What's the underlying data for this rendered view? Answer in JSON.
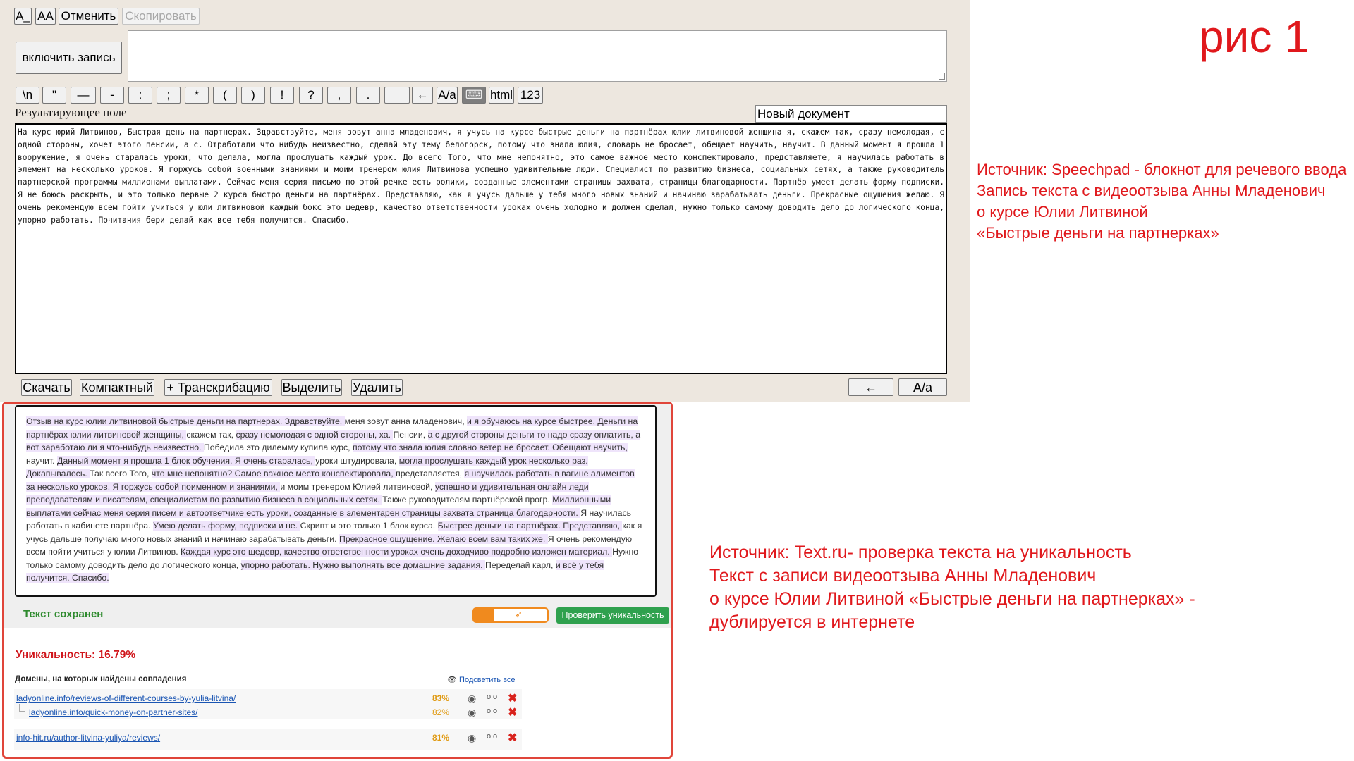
{
  "speechpad": {
    "top_buttons": [
      "A_",
      "AA",
      "Отменить",
      "Скопировать"
    ],
    "record_button": "включить запись",
    "punct_buttons": [
      "\\n",
      "\"",
      "—",
      "-",
      ":",
      ";",
      "*",
      "(",
      ")",
      "!",
      "?",
      ",",
      ".",
      "",
      "←",
      "A/a",
      "",
      "html",
      "123"
    ],
    "result_label": "Результирующее поле",
    "doc_name": "Новый документ",
    "result_text": "На курс юрий Литвинов, Быстрая день на партнерах. Здравствуйте, меня зовут анна младенович, я учусь на курсе быстрые деньги на партнёрах юлии литвиновой женщина я, скажем так, сразу немолодая, с одной стороны, хочет этого пенсии, а с. Отработали что нибудь неизвестно, сделай эту тему белогорск, потому что знала юлия, словарь не бросает, обещает научить, научит. В данный момент я прошла 1 вооружение, я очень старалась уроки, что делала, могла прослушать каждый урок. До всего Того, что мне непонятно, это самое важное место конспектировало, представляете, я научилась работать в элемент на несколько уроков. Я горжусь собой военными знаниями и моим тренером юлия Литвинова успешно удивительные люди. Специалист по развитию бизнеса, социальных сетях, а также руководитель партнерской программы миллионами выплатами. Сейчас меня серия письмо по этой речке есть ролики, созданные элементами страницы захвата, страницы благодарности. Партнёр умеет делать форму подписки. Я не боюсь раскрыть, и это только первые 2 курса быстро деньги на партнёрах. Представляю, как я учусь дальше у тебя много новых знаний и начинаю зарабатывать деньги. Прекрасные ощущения желаю. Я очень рекомендую всем пойти учиться у юли литвиновой каждый бокс это шедевр, качество ответственности уроках очень холодно и должен сделал, нужно только самому доводить дело до логического конца, упорно работать. Почитания бери делай как все тебя получится. Спасибо.",
    "bottom_buttons": [
      "Скачать",
      "Компактный",
      "+ Транскрибацию",
      "Выделить",
      "Удалить"
    ],
    "bottom_right_buttons": [
      "←",
      "A/a"
    ]
  },
  "figure_label": "рис 1",
  "caption1": [
    "Источник: Speechpad - блокнот для речевого ввода",
    "Запись текста с видеоотзыва Анны Младенович",
    "о курсе Юлии Литвиной",
    "«Быстрые деньги на партнерках»"
  ],
  "caption2": [
    "Источник: Text.ru- проверка текста на уникальность",
    "Текст с записи видеоотзыва Анны Младенович",
    "о курсе Юлии Литвиной «Быстрые деньги на партнерках» -",
    "дублируется в интернете"
  ],
  "textru": {
    "text": "Отзыв на курс юлии литвиновой быстрые деньги на партнерах. Здравствуйте, меня зовут анна младенович, и я обучаюсь на курсе быстрее. Деньги на партнёрах юлии литвиновой женщины, скажем так, сразу немолодая с одной стороны, ха. Пенсии, а с другой стороны деньги то надо сразу оплатить, а вот заработаю ли я что-нибудь неизвестно. Победила это дилемму купила курс, потому что знала юлия словно ветер не бросает. Обещают научить, научит. Данный момент я прошла 1 блок обучения. Я очень старалась, уроки штудировала, могла прослушать каждый урок несколько раз. Докапывалось. Так всего Того, что мне непонятно? Самое важное место конспектировала, представляется, я научилась работать в вагине алиментов за несколько уроков. Я горжусь собой поименном и знаниями, и моим тренером Юлией литвиновой, успешно и удивительная онлайн леди преподавателям и писателям, специалистам по развитию бизнеса в социальных сетях. Также руководителям партнёрской прогр. Миллионными выплатами сейчас меня серия писем и автоответчике есть уроки, созданные в элементарен страницы захвата страница благодарности. Я научилась работать в кабинете партнёра. Умею делать форму, подписки и не. Скрипт и это только 1 блок курса. Быстрее деньги на партнёрах. Представляю, как я учусь дальше получаю много новых знаний и начинаю зарабатывать деньги. Прекрасное ощущение. Желаю всем вам таких же. Я очень рекомендую всем пойти учиться у юлии Литвинов. Каждая курс это шедевр, качество ответственности уроках очень доходчиво подробно изложен материал. Нужно только самому доводить дело до логического конца, упорно работать. Нужно выполнять все домашние задания. Переделай карл, и всё у тебя получится. Спасибо.",
    "saved": "Текст сохранен",
    "check_button": "Проверить уникальность",
    "uniqueness": "Уникальность: 16.79%",
    "domains_heading": "Домены, на которых найдены совпадения",
    "highlight_all": "Подсветить все",
    "domains": [
      {
        "url": "ladyonline.info/reviews-of-different-courses-by-yulia-litvina/",
        "pct": "83%"
      },
      {
        "url": "ladyonline.info/quick-money-on-partner-sites/",
        "pct": "82%"
      },
      {
        "url": "info-hit.ru/author-litvina-yuliya/reviews/",
        "pct": "81%"
      }
    ]
  }
}
